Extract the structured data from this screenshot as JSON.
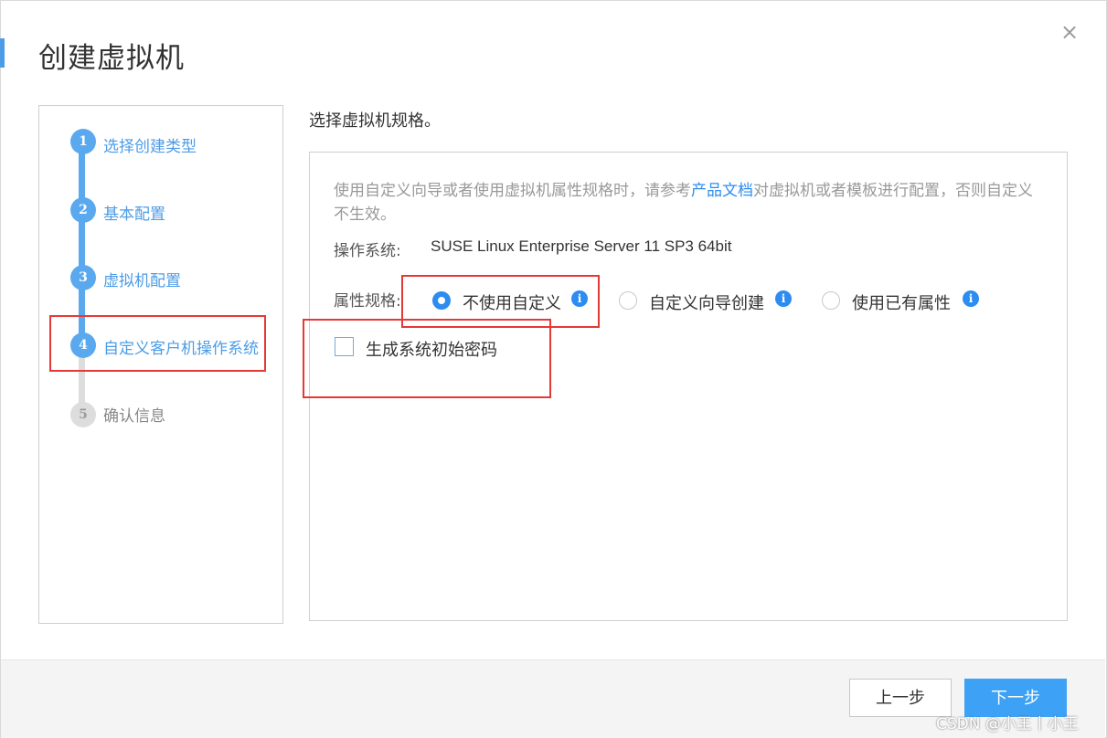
{
  "dialog": {
    "title": "创建虚拟机",
    "close_glyph": "×"
  },
  "steps": [
    {
      "number": "1",
      "label": "选择创建类型",
      "state": "done"
    },
    {
      "number": "2",
      "label": "基本配置",
      "state": "done"
    },
    {
      "number": "3",
      "label": "虚拟机配置",
      "state": "done"
    },
    {
      "number": "4",
      "label": "自定义客户机操作系统",
      "state": "active"
    },
    {
      "number": "5",
      "label": "确认信息",
      "state": "pending"
    }
  ],
  "content": {
    "heading": "选择虚拟机规格。",
    "hint_before": "使用自定义向导或者使用虚拟机属性规格时，请参考",
    "hint_link": "产品文档",
    "hint_after": "对虚拟机或者模板进行配置，否则自定义不生效。",
    "os_label": "操作系统:",
    "os_value": "SUSE Linux Enterprise Server 11 SP3 64bit",
    "spec_label": "属性规格:",
    "spec_options": [
      {
        "label": "不使用自定义",
        "selected": true,
        "info_icon": "info-icon"
      },
      {
        "label": "自定义向导创建",
        "selected": false,
        "info_icon": "info-icon"
      },
      {
        "label": "使用已有属性",
        "selected": false,
        "info_icon": "info-icon"
      }
    ],
    "password_checkbox": {
      "label": "生成系统初始密码",
      "checked": false
    }
  },
  "footer": {
    "prev_label": "上一步",
    "next_label": "下一步"
  },
  "watermark": "CSDN @小王丨小王",
  "colors": {
    "accent": "#4d9ce6",
    "primary_button": "#3da2f5",
    "link": "#2d8cf0",
    "highlight_box": "#e53935",
    "pending_step": "#dddddd"
  }
}
